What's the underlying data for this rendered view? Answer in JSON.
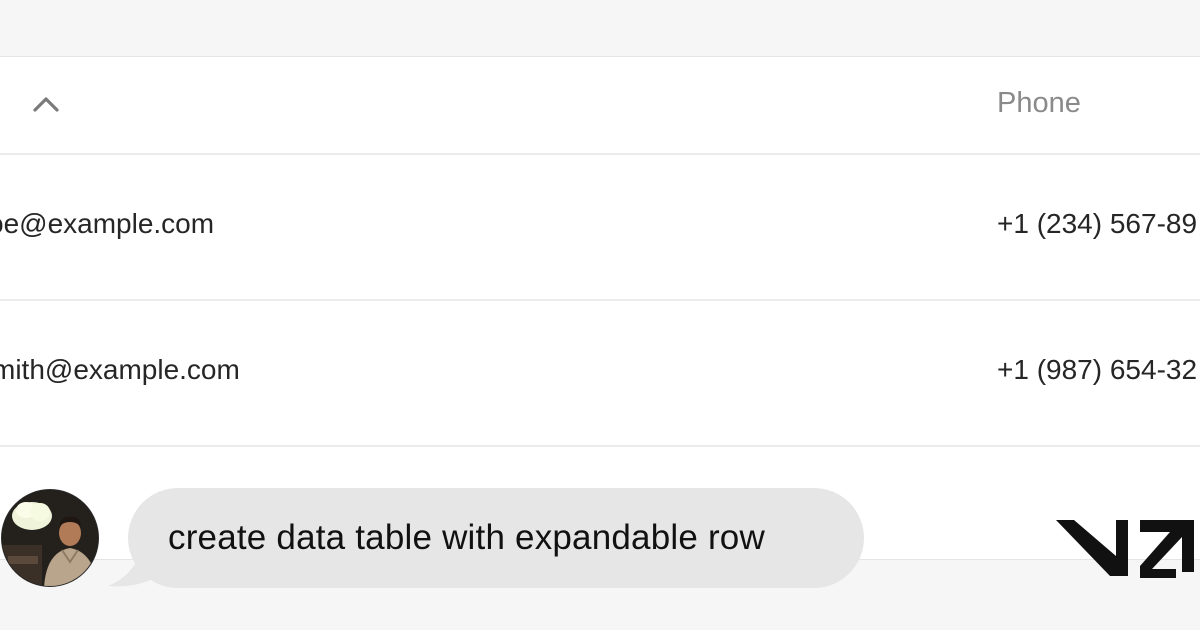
{
  "table": {
    "header": {
      "columns": [
        {
          "label": ""
        },
        {
          "label": "Phone"
        }
      ]
    },
    "rows": [
      {
        "email": "oe@example.com",
        "phone": "+1 (234) 567-89"
      },
      {
        "email": "mith@example.com",
        "phone": "+1 (987) 654-32"
      }
    ]
  },
  "chat": {
    "message": "create data table with expandable row"
  },
  "icons": {
    "sort": "chevron-up-icon",
    "brand": "v0-logo-icon",
    "avatar": "user-avatar"
  },
  "colors": {
    "page_background": "#f6f6f6",
    "table_background": "#ffffff",
    "header_text": "#8a8a8a",
    "cell_text": "#262626",
    "bubble_background": "#e6e6e6",
    "brand": "#111111"
  }
}
